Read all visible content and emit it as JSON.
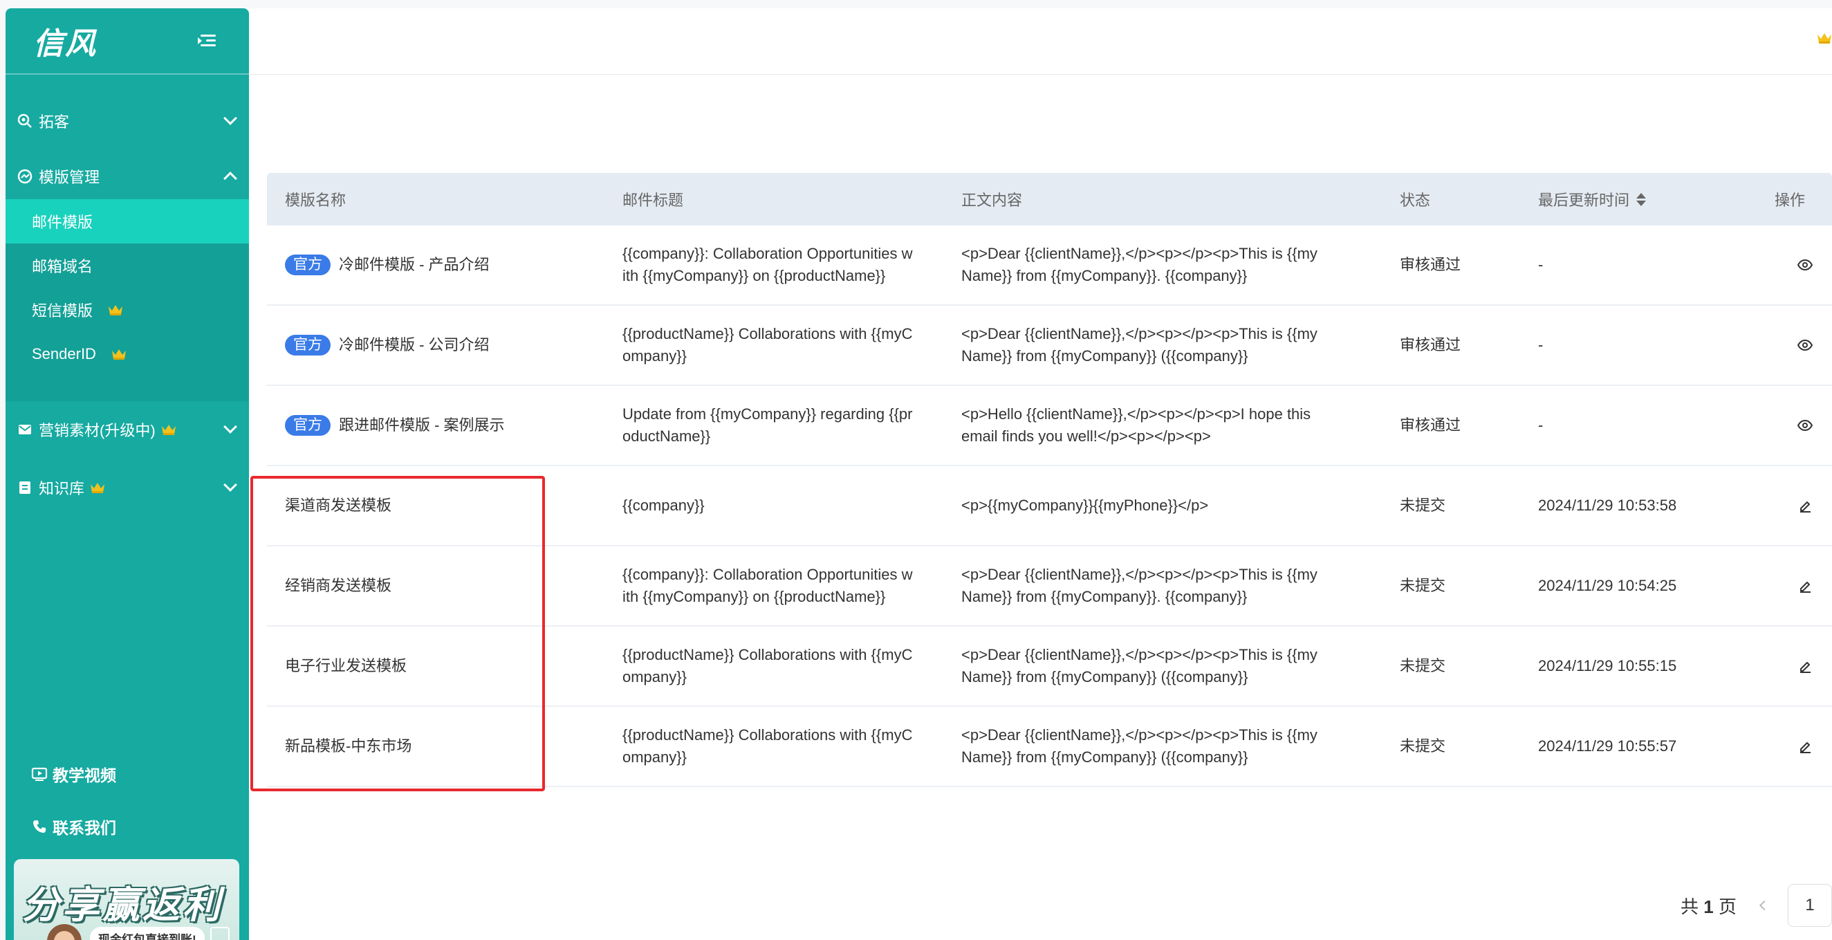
{
  "sidebar": {
    "logo": "信风",
    "menu": [
      {
        "label": "拓客",
        "icon": "search-customer-icon"
      },
      {
        "label": "模版管理",
        "icon": "template-icon"
      },
      {
        "label": "营销素材(升级中)",
        "icon": "marketing-material-icon"
      },
      {
        "label": "知识库",
        "icon": "knowledge-base-icon"
      }
    ],
    "submenu": [
      {
        "label": "邮件模版"
      },
      {
        "label": "邮箱域名"
      },
      {
        "label": "短信模版"
      },
      {
        "label": "SenderID"
      }
    ],
    "bottom_links": [
      {
        "label": "教学视频",
        "icon": "video-icon"
      },
      {
        "label": "联系我们",
        "icon": "phone-icon"
      }
    ],
    "promo": {
      "title": "分享赢返利",
      "subtitle": "现金红包直接到账!"
    }
  },
  "colors": {
    "sidebar": "#16aaa1",
    "active_item": "#19d2bd",
    "badge": "#3a7be8",
    "crown": "#f4c21b",
    "highlight": "#e8292e"
  },
  "table": {
    "headers": {
      "name": "模版名称",
      "subject": "邮件标题",
      "body": "正文内容",
      "status": "状态",
      "updated": "最后更新时间",
      "action": "操作"
    },
    "rows": [
      {
        "badge": "官方",
        "name": "冷邮件模版 - 产品介绍",
        "subject": "{{company}}: Collaboration Opportunities with {{myCompany}} on {{productName}}",
        "body": "<p>Dear {{clientName}},</p><p></p><p>This is {{myName}} from {{myCompany}}. {{company}}",
        "status": "审核通过",
        "updated": "-",
        "action": "view"
      },
      {
        "badge": "官方",
        "name": "冷邮件模版 - 公司介绍",
        "subject": "{{productName}} Collaborations with {{myCompany}}",
        "body": "<p>Dear {{clientName}},</p><p></p><p>This is {{myName}} from {{myCompany}} ({{company}}",
        "status": "审核通过",
        "updated": "-",
        "action": "view"
      },
      {
        "badge": "官方",
        "name": "跟进邮件模版 - 案例展示",
        "subject": "Update from {{myCompany}} regarding {{productName}}",
        "body": "<p>Hello {{clientName}},</p><p></p><p>I hope this email finds you well!</p><p></p><p>",
        "status": "审核通过",
        "updated": "-",
        "action": "view"
      },
      {
        "badge": "",
        "name": "渠道商发送模板",
        "subject": "{{company}}",
        "body": "<p>{{myCompany}}{{myPhone}}</p>",
        "status": "未提交",
        "updated": "2024/11/29 10:53:58",
        "action": "edit"
      },
      {
        "badge": "",
        "name": "经销商发送模板",
        "subject": "{{company}}: Collaboration Opportunities with {{myCompany}} on {{productName}}",
        "body": "<p>Dear {{clientName}},</p><p></p><p>This is {{myName}} from {{myCompany}}. {{company}}",
        "status": "未提交",
        "updated": "2024/11/29 10:54:25",
        "action": "edit"
      },
      {
        "badge": "",
        "name": "电子行业发送模板",
        "subject": "{{productName}} Collaborations with {{myCompany}}",
        "body": "<p>Dear {{clientName}},</p><p></p><p>This is {{myName}} from {{myCompany}} ({{company}}",
        "status": "未提交",
        "updated": "2024/11/29 10:55:15",
        "action": "edit"
      },
      {
        "badge": "",
        "name": "新品模板-中东市场",
        "subject": "{{productName}} Collaborations with {{myCompany}}",
        "body": "<p>Dear {{clientName}},</p><p></p><p>This is {{myName}} from {{myCompany}} ({{company}}",
        "status": "未提交",
        "updated": "2024/11/29 10:55:57",
        "action": "edit"
      }
    ]
  },
  "pager": {
    "prefix": "共",
    "total": "1",
    "suffix": "页",
    "current": "1"
  }
}
